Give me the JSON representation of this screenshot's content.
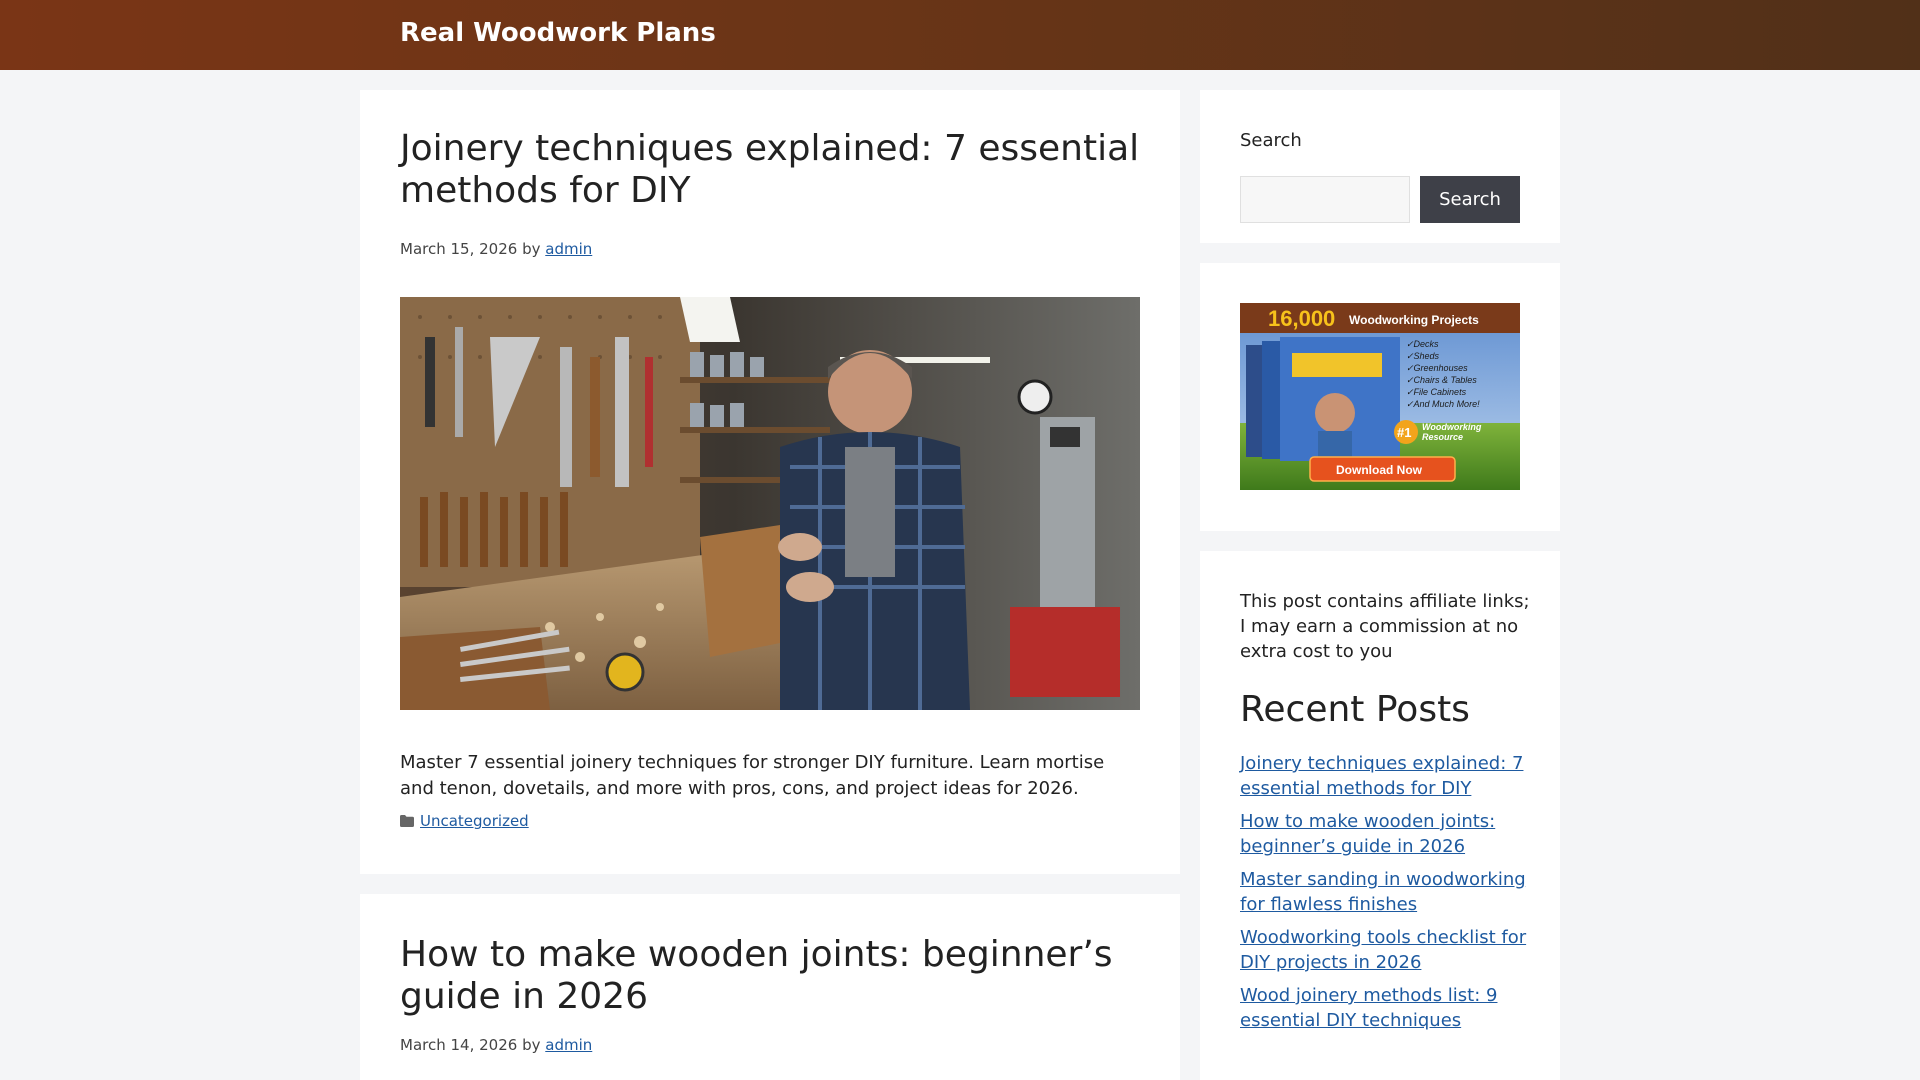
{
  "header": {
    "site_title": "Real Woodwork Plans"
  },
  "posts": [
    {
      "title": "Joinery techniques explained: 7 essential methods for DIY",
      "date": "March 15, 2026",
      "by": "by",
      "author": "admin",
      "excerpt": "Master 7 essential joinery techniques for stronger DIY furniture. Learn mortise and tenon, dovetails, and more with pros, cons, and project ideas for 2026.",
      "category": "Uncategorized"
    },
    {
      "title": "How to make wooden joints: beginner’s guide in 2026",
      "date": "March 14, 2026",
      "by": "by",
      "author": "admin"
    }
  ],
  "sidebar": {
    "search": {
      "label": "Search",
      "button_label": "Search",
      "value": ""
    },
    "ad": {
      "headline_number": "16,000",
      "headline_text": "Woodworking Projects",
      "list": [
        "✓Decks",
        "✓Sheds",
        "✓Greenhouses",
        "✓Chairs & Tables",
        "✓File Cabinets",
        "✓And Much More!"
      ],
      "badge_number": "#1",
      "badge_text_1": "Woodworking",
      "badge_text_2": "Resource",
      "cta": "Download Now"
    },
    "disclosure": "This post contains affiliate links; I may earn a commission at no extra cost to you",
    "recent_heading": "Recent Posts",
    "recent_posts": [
      "Joinery techniques explained: 7 essential methods for DIY",
      "How to make wooden joints: beginner’s guide in 2026",
      "Master sanding in woodworking for flawless finishes",
      "Woodworking tools checklist for DIY projects in 2026",
      "Wood joinery methods list: 9 essential DIY techniques"
    ]
  },
  "colors": {
    "header_start": "#7a3516",
    "header_end": "#513018",
    "link": "#1e5aa0",
    "button": "#3e4048"
  }
}
